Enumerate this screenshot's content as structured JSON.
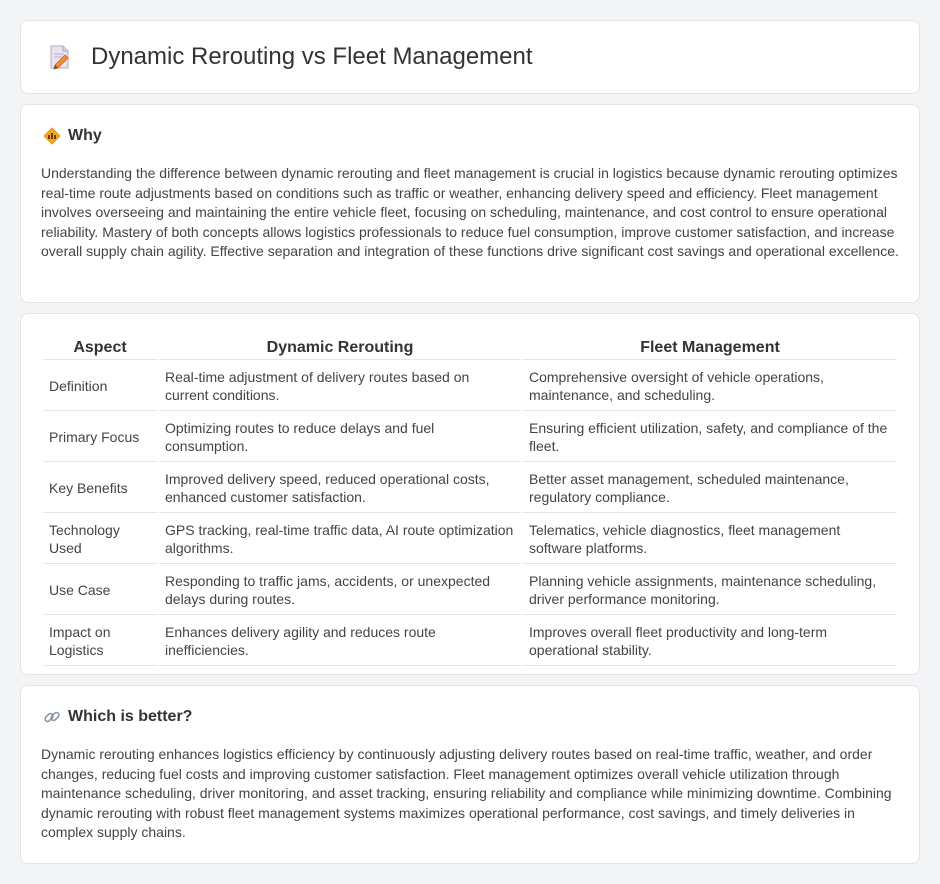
{
  "header": {
    "title": "Dynamic Rerouting vs Fleet Management",
    "icon": "document-pencil-icon"
  },
  "why": {
    "heading": "Why",
    "icon": "diamond-signal-icon",
    "text": "Understanding the difference between dynamic rerouting and fleet management is crucial in logistics because dynamic rerouting optimizes real-time route adjustments based on conditions such as traffic or weather, enhancing delivery speed and efficiency. Fleet management involves overseeing and maintaining the entire vehicle fleet, focusing on scheduling, maintenance, and cost control to ensure operational reliability. Mastery of both concepts allows logistics professionals to reduce fuel consumption, improve customer satisfaction, and increase overall supply chain agility. Effective separation and integration of these functions drive significant cost savings and operational excellence."
  },
  "comparison": {
    "headers": [
      "Aspect",
      "Dynamic Rerouting",
      "Fleet Management"
    ],
    "rows": [
      [
        "Definition",
        "Real-time adjustment of delivery routes based on current conditions.",
        "Comprehensive oversight of vehicle operations, maintenance, and scheduling."
      ],
      [
        "Primary Focus",
        "Optimizing routes to reduce delays and fuel consumption.",
        "Ensuring efficient utilization, safety, and compliance of the fleet."
      ],
      [
        "Key Benefits",
        "Improved delivery speed, reduced operational costs, enhanced customer satisfaction.",
        "Better asset management, scheduled maintenance, regulatory compliance."
      ],
      [
        "Technology Used",
        "GPS tracking, real-time traffic data, AI route optimization algorithms.",
        "Telematics, vehicle diagnostics, fleet management software platforms."
      ],
      [
        "Use Case",
        "Responding to traffic jams, accidents, or unexpected delays during routes.",
        "Planning vehicle assignments, maintenance scheduling, driver performance monitoring."
      ],
      [
        "Impact on Logistics",
        "Enhances delivery agility and reduces route inefficiencies.",
        "Improves overall fleet productivity and long-term operational stability."
      ]
    ]
  },
  "better": {
    "heading": "Which is better?",
    "icon": "link-icon",
    "text": "Dynamic rerouting enhances logistics efficiency by continuously adjusting delivery routes based on real-time traffic, weather, and order changes, reducing fuel costs and improving customer satisfaction. Fleet management optimizes overall vehicle utilization through maintenance scheduling, driver monitoring, and asset tracking, ensuring reliability and compliance while minimizing downtime. Combining dynamic rerouting with robust fleet management systems maximizes operational performance, cost savings, and timely deliveries in complex supply chains."
  }
}
